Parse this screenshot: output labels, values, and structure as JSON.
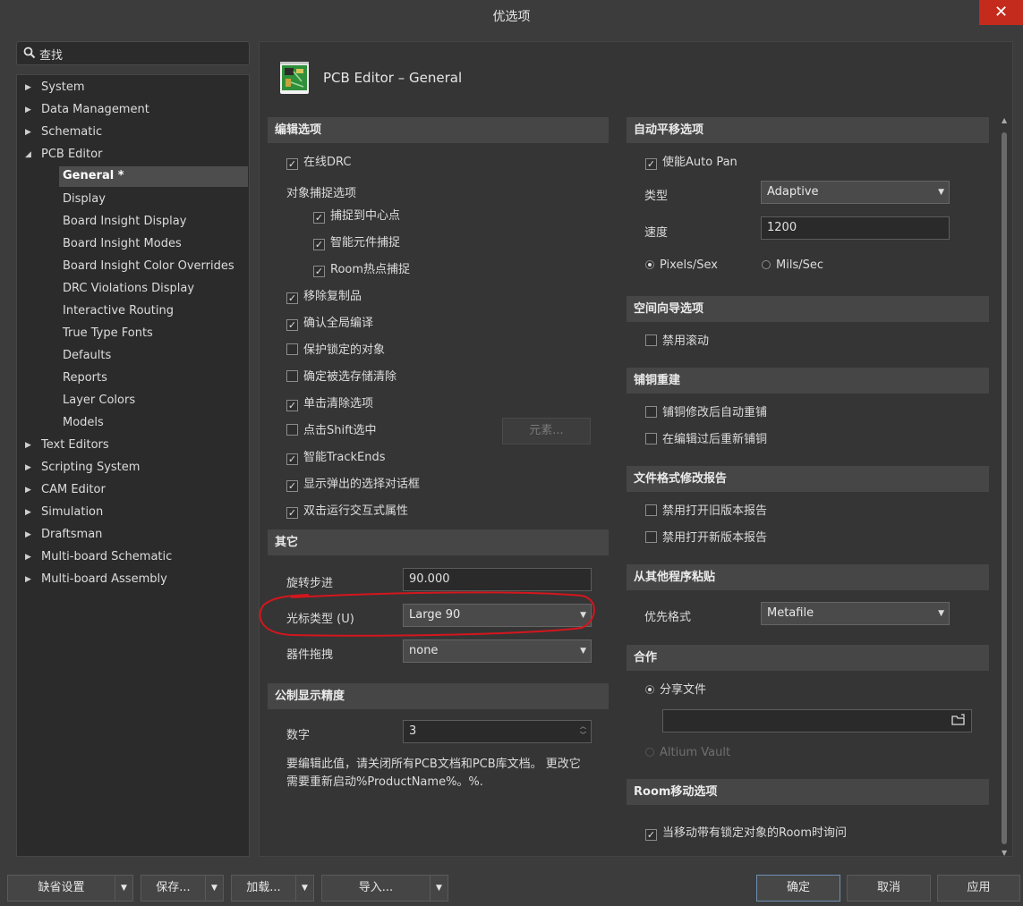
{
  "window": {
    "title": "优选项",
    "close": "✕"
  },
  "search": {
    "label": "查找"
  },
  "tree": {
    "items": [
      "System",
      "Data Management",
      "Schematic",
      "PCB Editor"
    ],
    "pcb_children": [
      "General *",
      "Display",
      "Board Insight Display",
      "Board Insight Modes",
      "Board Insight Color Overrides",
      "DRC Violations Display",
      "Interactive Routing",
      "True Type Fonts",
      "Defaults",
      "Reports",
      "Layer Colors",
      "Models"
    ],
    "items_after": [
      "Text Editors",
      "Scripting System",
      "CAM Editor",
      "Simulation",
      "Draftsman",
      "Multi-board Schematic",
      "Multi-board Assembly"
    ]
  },
  "page": {
    "title": "PCB Editor – General"
  },
  "edit": {
    "header": "编辑选项",
    "online_drc": "在线DRC",
    "snap_label": "对象捕捉选项",
    "snap_center": "捕捉到中心点",
    "smart_snap": "智能元件捕捉",
    "room_hotspot": "Room热点捕捉",
    "remove_dup": "移除复制品",
    "confirm_global": "确认全局编译",
    "protect_locked": "保护锁定的对象",
    "confirm_clear": "确定被选存储清除",
    "click_clear": "单击清除选项",
    "shift_select": "点击Shift选中",
    "elements_btn": "元素...",
    "smart_track": "智能TrackEnds",
    "show_popup": "显示弹出的选择对话框",
    "dbl_click": "双击运行交互式属性"
  },
  "other": {
    "header": "其它",
    "rotation_label": "旋转步进",
    "rotation_value": "90.000",
    "cursor_label": "光标类型 (U)",
    "cursor_value": "Large 90",
    "drag_label": "器件拖拽",
    "drag_value": "none"
  },
  "metric": {
    "header": "公制显示精度",
    "digits_label": "数字",
    "digits_value": "3",
    "note": "要编辑此值，请关闭所有PCB文档和PCB库文档。 更改它需要重新启动%ProductName%。%."
  },
  "autopan": {
    "header": "自动平移选项",
    "enable": "使能Auto Pan",
    "type_label": "类型",
    "type_value": "Adaptive",
    "speed_label": "速度",
    "speed_value": "1200",
    "pixels": "Pixels/Sex",
    "mils": "Mils/Sec"
  },
  "space_nav": {
    "header": "空间向导选项",
    "disable_roll": "禁用滚动"
  },
  "copper": {
    "header": "铺铜重建",
    "auto_repour": "铺铜修改后自动重铺",
    "repour_after_edit": "在编辑过后重新铺铜"
  },
  "file_format": {
    "header": "文件格式修改报告",
    "disable_old": "禁用打开旧版本报告",
    "disable_new": "禁用打开新版本报告"
  },
  "paste": {
    "header": "从其他程序粘贴",
    "pref_label": "优先格式",
    "pref_value": "Metafile"
  },
  "collab": {
    "header": "合作",
    "shared_file": "分享文件",
    "vault": "Altium Vault"
  },
  "room": {
    "header": "Room移动选项",
    "ask_locked": "当移动带有锁定对象的Room时询问"
  },
  "footer": {
    "defaults": "缺省设置",
    "save": "保存...",
    "load": "加载...",
    "import": "导入...",
    "ok": "确定",
    "cancel": "取消",
    "apply": "应用"
  }
}
